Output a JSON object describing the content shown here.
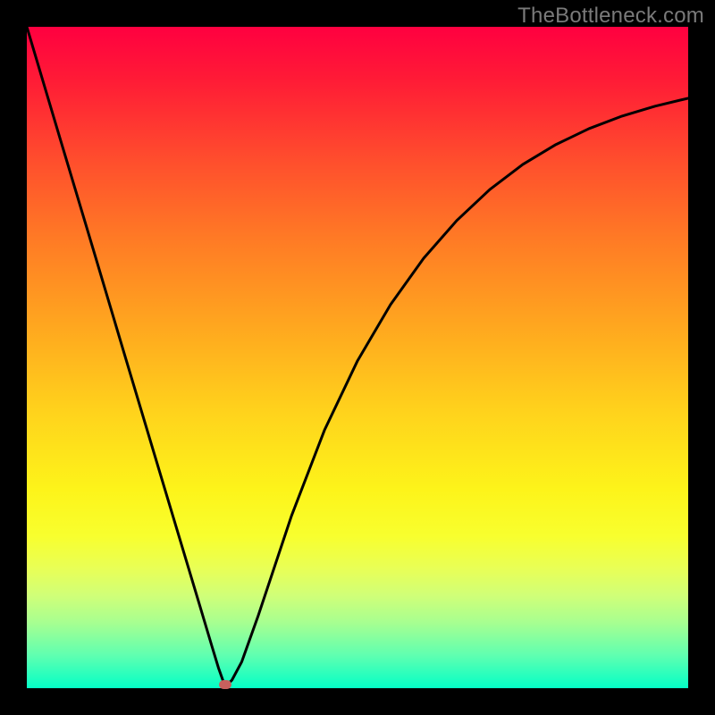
{
  "watermark": {
    "text": "TheBottleneck.com"
  },
  "chart_data": {
    "type": "line",
    "title": "",
    "xlabel": "",
    "ylabel": "",
    "xlim": [
      0,
      1
    ],
    "ylim": [
      0,
      1
    ],
    "grid": false,
    "series": [
      {
        "name": "curve",
        "x": [
          0.0,
          0.05,
          0.1,
          0.15,
          0.2,
          0.23,
          0.26,
          0.28,
          0.29,
          0.3,
          0.31,
          0.325,
          0.35,
          0.4,
          0.45,
          0.5,
          0.55,
          0.6,
          0.65,
          0.7,
          0.75,
          0.8,
          0.85,
          0.9,
          0.95,
          1.0
        ],
        "y": [
          1.0,
          0.832,
          0.665,
          0.497,
          0.33,
          0.23,
          0.13,
          0.063,
          0.03,
          0.002,
          0.012,
          0.04,
          0.11,
          0.26,
          0.39,
          0.495,
          0.58,
          0.65,
          0.707,
          0.754,
          0.792,
          0.822,
          0.846,
          0.865,
          0.88,
          0.892
        ]
      }
    ],
    "marker": {
      "x": 0.3,
      "y": 0.0
    },
    "gradient_stops": [
      {
        "pos": 0.0,
        "color": "#ff0040"
      },
      {
        "pos": 0.5,
        "color": "#ffb81f"
      },
      {
        "pos": 0.75,
        "color": "#f9ff25"
      },
      {
        "pos": 1.0,
        "color": "#04ffc6"
      }
    ]
  }
}
